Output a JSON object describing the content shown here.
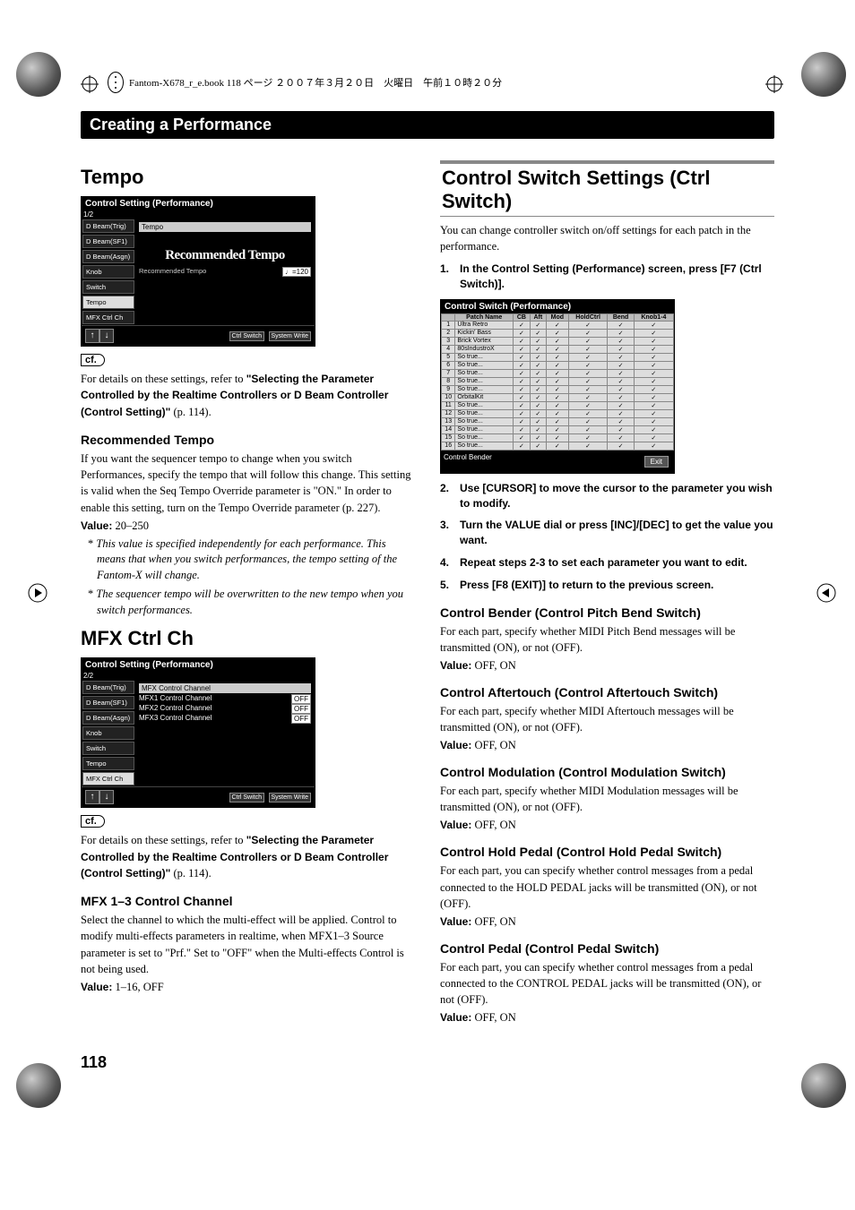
{
  "header": {
    "book_line": "Fantom-X678_r_e.book  118 ページ  ２００７年３月２０日　火曜日　午前１０時２０分"
  },
  "section_bar": "Creating a Performance",
  "left": {
    "tempo": {
      "heading": "Tempo",
      "screenshot": {
        "title": "Control Setting (Performance)",
        "tab_row": "1/2",
        "side_tabs": [
          "D Beam(Trig)",
          "D Beam(SF1)",
          "D Beam(Asgn)",
          "Knob",
          "Switch",
          "Tempo",
          "MFX Ctrl Ch"
        ],
        "active_tab": "Tempo",
        "content_label": "Tempo",
        "logo": "Recommended Tempo",
        "param_line": "Recommended Tempo",
        "param_value": "♩=120",
        "footer_buttons": [
          "Ctrl Switch",
          "System Write"
        ]
      },
      "cf": "cf.",
      "ref_prefix": "For details on these settings, refer to ",
      "ref_bold": "\"Selecting the Parameter Controlled by the Realtime Controllers or D Beam Controller (Control Setting)\"",
      "ref_suffix": " (p. 114).",
      "rec_heading": "Recommended Tempo",
      "rec_body": "If you want the sequencer tempo to change when you switch Performances, specify the tempo that will follow this change. This setting is valid when the Seq Tempo Override parameter is \"ON.\" In order to enable this setting, turn on the Tempo Override parameter (p. 227).",
      "rec_value_label": "Value:",
      "rec_value": " 20–250",
      "note1": "This value is specified independently for each performance. This means that when you switch performances, the tempo setting of the Fantom-X will change.",
      "note2": "The sequencer tempo will be overwritten to the new tempo when you switch performances."
    },
    "mfx": {
      "heading": "MFX Ctrl Ch",
      "screenshot": {
        "title": "Control Setting (Performance)",
        "tab_row": "2/2",
        "side_tabs": [
          "D Beam(Trig)",
          "D Beam(SF1)",
          "D Beam(Asgn)",
          "Knob",
          "Switch",
          "Tempo",
          "MFX Ctrl Ch"
        ],
        "active_tab": "MFX Ctrl Ch",
        "content_title": "MFX Control Channel",
        "rows": [
          {
            "label": "MFX1 Control Channel",
            "value": "OFF"
          },
          {
            "label": "MFX2 Control Channel",
            "value": "OFF"
          },
          {
            "label": "MFX3 Control Channel",
            "value": "OFF"
          }
        ],
        "footer_buttons": [
          "Ctrl Switch",
          "System Write"
        ]
      },
      "cf": "cf.",
      "ref_prefix": "For details on these settings, refer to ",
      "ref_bold": "\"Selecting the Parameter Controlled by the Realtime Controllers or D Beam Controller (Control Setting)\"",
      "ref_suffix": " (p. 114).",
      "ch_heading": "MFX 1–3 Control Channel",
      "ch_body": "Select the channel to which the multi-effect will be applied. Control to modify multi-effects parameters in realtime, when MFX1–3 Source parameter is set to \"Prf.\" Set to \"OFF\" when the Multi-effects Control is not being used.",
      "ch_value_label": "Value:",
      "ch_value": " 1–16, OFF"
    }
  },
  "right": {
    "title": "Control Switch Settings (Ctrl Switch)",
    "intro": "You can change controller switch on/off settings for each patch in the performance.",
    "steps": [
      "In the Control Setting (Performance) screen, press [F7 (Ctrl Switch)].",
      "Use [CURSOR] to move the cursor to the parameter you wish to modify.",
      "Turn the VALUE dial or press [INC]/[DEC] to get the value you want.",
      "Repeat steps 2-3 to set each parameter you want to edit.",
      "Press [F8 (EXIT)] to return to the previous screen."
    ],
    "screenshot": {
      "title": "Control Switch (Performance)",
      "columns": [
        "",
        "Patch Name",
        "CB",
        "Aft",
        "Mod",
        "HoldCtrl",
        "Bend",
        "Knob1-4"
      ],
      "rows": [
        {
          "n": "1",
          "name": "Ultra Retro"
        },
        {
          "n": "2",
          "name": "Kickin' Bass"
        },
        {
          "n": "3",
          "name": "Brick Vortex"
        },
        {
          "n": "4",
          "name": "80sIndustroX"
        },
        {
          "n": "5",
          "name": "So true..."
        },
        {
          "n": "6",
          "name": "So true..."
        },
        {
          "n": "7",
          "name": "So true..."
        },
        {
          "n": "8",
          "name": "So true..."
        },
        {
          "n": "9",
          "name": "So true..."
        },
        {
          "n": "10",
          "name": "OrbitalKit"
        },
        {
          "n": "11",
          "name": "So true..."
        },
        {
          "n": "12",
          "name": "So true..."
        },
        {
          "n": "13",
          "name": "So true..."
        },
        {
          "n": "14",
          "name": "So true..."
        },
        {
          "n": "15",
          "name": "So true..."
        },
        {
          "n": "16",
          "name": "So true..."
        }
      ],
      "cell_mark": "✓",
      "below_label": "Control Bender",
      "exit": "Exit"
    },
    "params": [
      {
        "heading": "Control Bender (Control Pitch Bend Switch)",
        "body": "For each part, specify whether MIDI Pitch Bend messages will be transmitted (ON), or not (OFF).",
        "value_label": "Value:",
        "value": " OFF, ON"
      },
      {
        "heading": "Control Aftertouch (Control Aftertouch Switch)",
        "body": "For each part, specify whether MIDI Aftertouch messages will be transmitted (ON), or not (OFF).",
        "value_label": "Value:",
        "value": " OFF, ON"
      },
      {
        "heading": "Control Modulation (Control Modulation Switch)",
        "body": "For each part, specify whether MIDI Modulation messages will be transmitted (ON), or not (OFF).",
        "value_label": "Value:",
        "value": " OFF, ON"
      },
      {
        "heading": "Control Hold Pedal (Control Hold Pedal Switch)",
        "body": "For each part, you can specify whether control messages from a pedal connected to the HOLD PEDAL jacks will be transmitted (ON), or not (OFF).",
        "value_label": "Value:",
        "value": " OFF, ON"
      },
      {
        "heading": "Control Pedal (Control Pedal Switch)",
        "body": "For each part, you can specify whether control messages from a pedal connected to the CONTROL PEDAL jacks will be transmitted (ON), or not (OFF).",
        "value_label": "Value:",
        "value": " OFF, ON"
      }
    ]
  },
  "page_number": "118"
}
